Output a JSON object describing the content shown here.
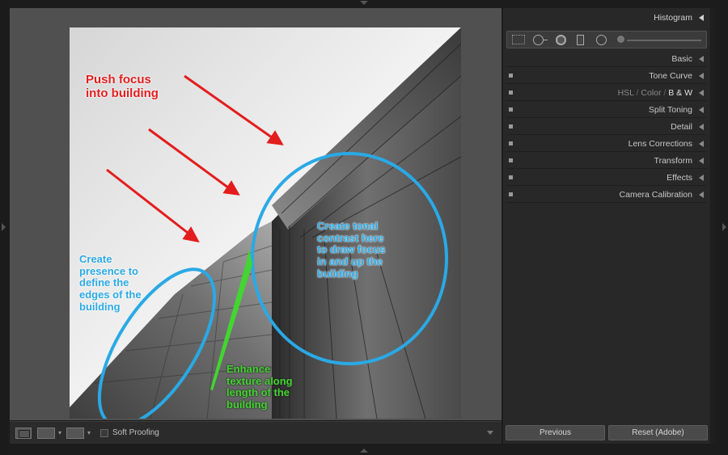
{
  "panel": {
    "histogram_label": "Histogram",
    "sections": [
      {
        "label": "Basic",
        "has_switch": false
      },
      {
        "label": "Tone Curve",
        "has_switch": true
      },
      {
        "label": "HSL / Color / B & W",
        "has_switch": true
      },
      {
        "label": "Split Toning",
        "has_switch": true
      },
      {
        "label": "Detail",
        "has_switch": true
      },
      {
        "label": "Lens Corrections",
        "has_switch": true
      },
      {
        "label": "Transform",
        "has_switch": true
      },
      {
        "label": "Effects",
        "has_switch": true
      },
      {
        "label": "Camera Calibration",
        "has_switch": true
      }
    ],
    "hsl_parts": {
      "hsl": "HSL",
      "sep": "/",
      "color": "Color",
      "bw": "B & W"
    },
    "previous_label": "Previous",
    "reset_label": "Reset (Adobe)"
  },
  "toolbar": {
    "soft_proofing_label": "Soft Proofing",
    "soft_proofing_checked": false
  },
  "tools": [
    "crop-overlay-icon",
    "spot-removal-icon",
    "red-eye-icon",
    "graduated-filter-icon",
    "radial-filter-icon",
    "adjustment-brush-icon"
  ],
  "annotations": {
    "red": "Push focus\ninto building",
    "blue_left": "Create\npresence to\ndefine the\nedges of the\nbuilding",
    "blue_right": "Create tonal\ncontrast here\nto draw focus\nin and up the\nbuilding",
    "green": "Enhance\ntexture along\nlength of the\nbuilding"
  },
  "colors": {
    "annotation_red": "#e31d1d",
    "annotation_blue": "#2aa9e5",
    "annotation_green": "#43d531",
    "panel_bg": "#282828",
    "canvas_bg": "#505050"
  }
}
